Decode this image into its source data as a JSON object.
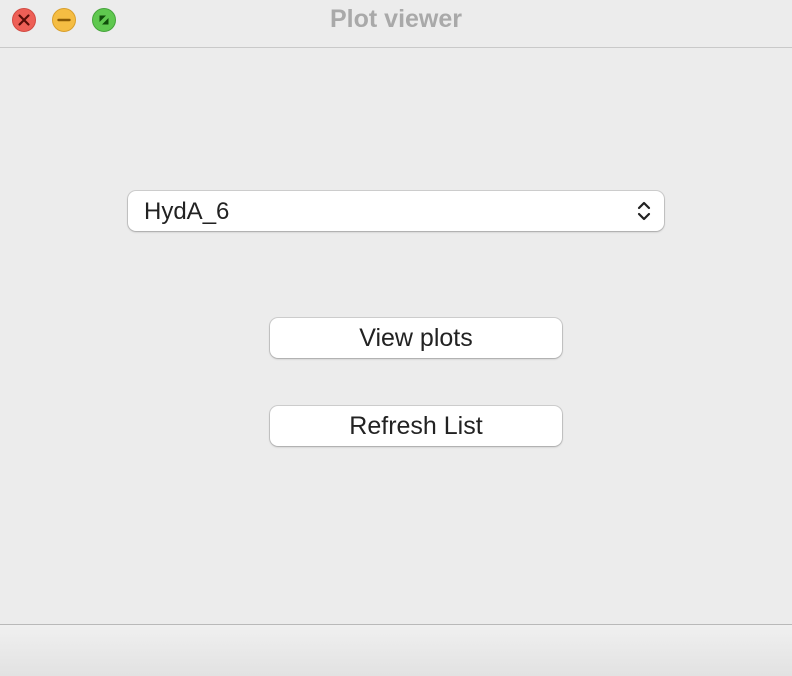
{
  "window": {
    "title": "Plot viewer"
  },
  "combo": {
    "selected": "HydA_6"
  },
  "buttons": {
    "view_plots": "View plots",
    "refresh_list": "Refresh List"
  }
}
